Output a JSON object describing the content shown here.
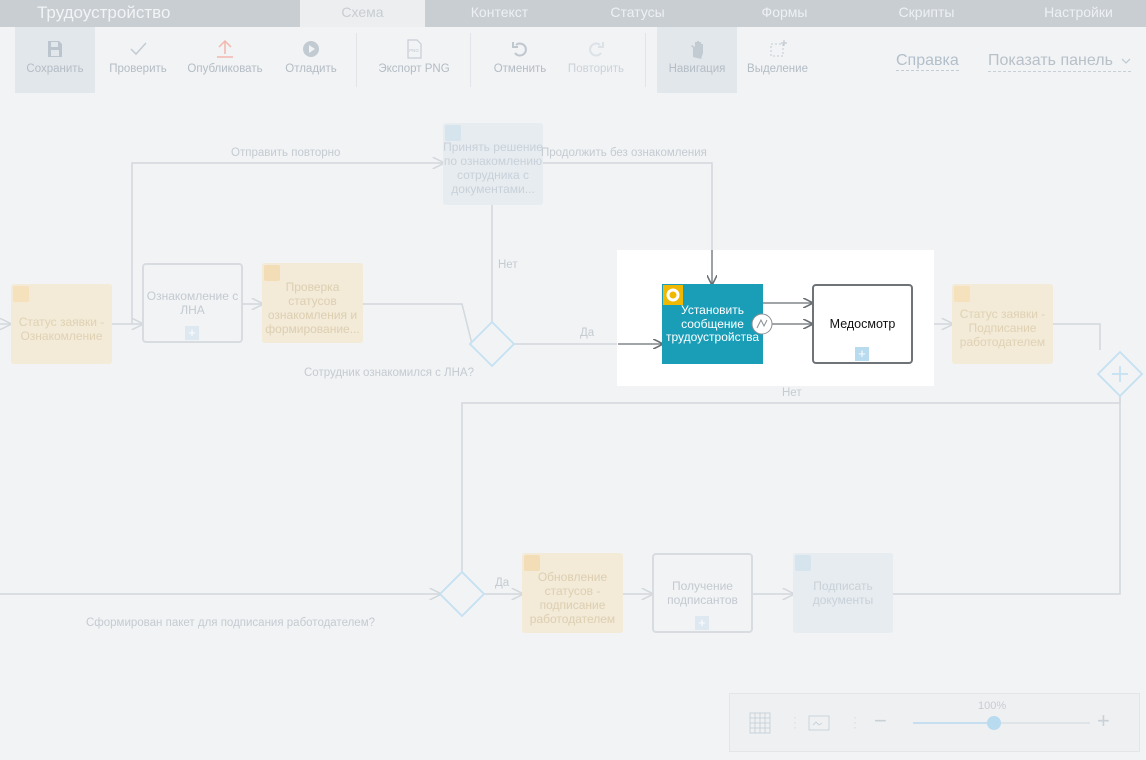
{
  "app": {
    "title": "Трудоустройство"
  },
  "tabs": [
    {
      "label": "Схема",
      "active": true
    },
    {
      "label": "Контекст"
    },
    {
      "label": "Статусы"
    },
    {
      "label": "Формы"
    },
    {
      "label": "Скрипты"
    },
    {
      "label": "Настройки"
    }
  ],
  "toolbar": {
    "save": "Сохранить",
    "check": "Проверить",
    "publish": "Опубликовать",
    "debug": "Отладить",
    "export_png": "Экспорт PNG",
    "undo": "Отменить",
    "redo": "Повторить",
    "navigation": "Навигация",
    "selection": "Выделение",
    "png_badge": "PNG",
    "help": "Справка",
    "show_panel": "Показать панель"
  },
  "diagram": {
    "nodes": {
      "status_review": "Статус заявки - Ознакомление",
      "lna_review": "Ознакомление с ЛНА",
      "check_statuses": "Проверка статусов ознакомления и формирование...",
      "decide_review": "Принять решение по ознакомлению сотрудника с документами...",
      "set_message": "Установить сообщение трудоустройства",
      "medical": "Медосмотр",
      "status_sign": "Статус заявки - Подписание работодателем",
      "update_statuses": "Обновление статусов - подписание работодателем",
      "get_signers": "Получение подписантов",
      "sign_docs": "Подписать документы"
    },
    "flow_labels": {
      "resend": "Отправить повторно",
      "continue_without": "Продолжить без ознакомления",
      "no_top": "Нет",
      "yes_mid": "Да",
      "gateway_lna": "Сотрудник ознакомился с ЛНА?",
      "no_mid": "Нет",
      "yes_bottom": "Да",
      "gateway_package": "Сформирован пакет для подписания работодателем?"
    }
  },
  "zoom": {
    "level": "100%",
    "fraction": 0.46
  },
  "colors": {
    "active_task": "#1a9eb8",
    "gear_badge": "#f0b800",
    "status_node": "#f3ead7",
    "accent_blue": "#b9dbf0"
  },
  "icons": {
    "save": "floppy-icon",
    "check": "checkmark-icon",
    "publish": "upload-arrow-icon",
    "debug": "play-icon",
    "export": "png-file-icon",
    "undo": "undo-icon",
    "redo": "redo-icon",
    "navigation": "hand-icon",
    "selection": "selection-box-icon"
  }
}
